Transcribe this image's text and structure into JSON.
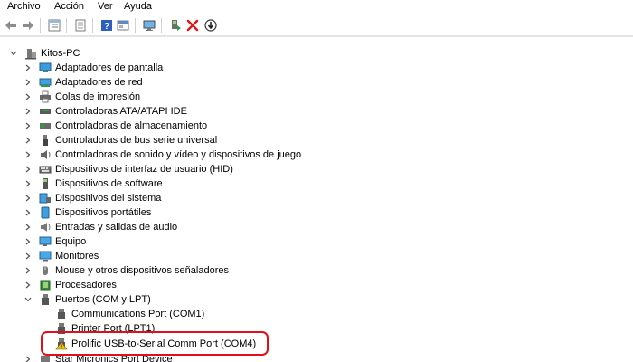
{
  "menu": [
    "Archivo",
    "Acción",
    "Ver",
    "Ayuda"
  ],
  "toolbar": {
    "buttons": [
      "back-icon",
      "forward-icon",
      "tree-view-icon",
      "properties-icon",
      "help-icon",
      "panel-icon",
      "monitor-icon",
      "add-driver-icon",
      "uninstall-icon",
      "download-icon"
    ]
  },
  "tree": {
    "root": "Kitos-PC",
    "categories": [
      "Adaptadores de pantalla",
      "Adaptadores de red",
      "Colas de impresión",
      "Controladoras ATA/ATAPI IDE",
      "Controladoras de almacenamiento",
      "Controladoras de bus serie universal",
      "Controladoras de sonido y vídeo y dispositivos de juego",
      "Dispositivos de interfaz de usuario (HID)",
      "Dispositivos de software",
      "Dispositivos del sistema",
      "Dispositivos portátiles",
      "Entradas y salidas de audio",
      "Equipo",
      "Monitores",
      "Mouse y otros dispositivos señaladores",
      "Procesadores",
      "Puertos (COM y LPT)"
    ],
    "ports_children": [
      "Communications Port (COM1)",
      "Printer Port (LPT1)",
      "Prolific USB-to-Serial Comm Port (COM4)"
    ],
    "next_category": "Star Micronics Port Device"
  },
  "colors": {
    "highlight": "#e0101a",
    "warning": "#f2c200"
  }
}
